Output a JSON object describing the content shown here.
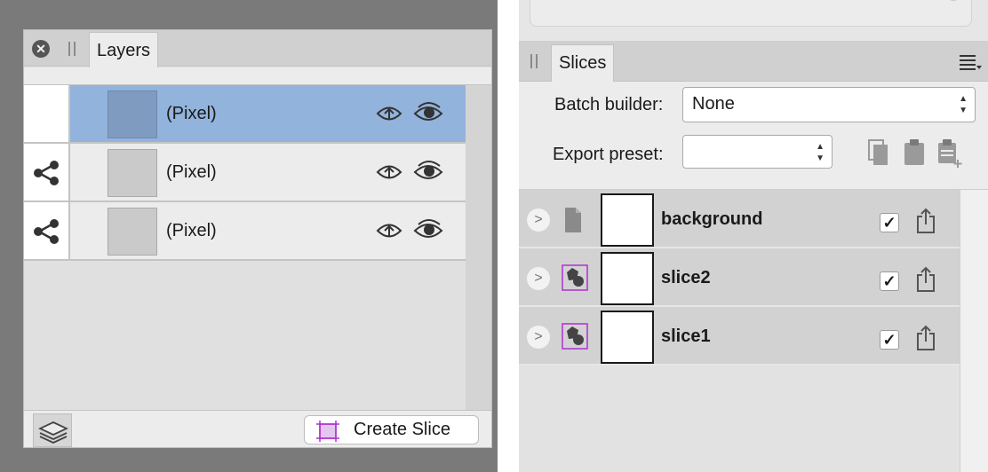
{
  "layers_panel": {
    "tab_label": "Layers",
    "layers": [
      {
        "label": "(Pixel)",
        "selected": true,
        "has_link": false
      },
      {
        "label": "(Pixel)",
        "selected": false,
        "has_link": true
      },
      {
        "label": "(Pixel)",
        "selected": false,
        "has_link": true
      }
    ],
    "footer": {
      "create_slice_label": "Create Slice"
    }
  },
  "slices_panel": {
    "tab_label": "Slices",
    "batch_builder": {
      "label": "Batch builder:",
      "value": "None"
    },
    "export_preset": {
      "label": "Export preset:",
      "value": ""
    },
    "slices": [
      {
        "name": "background",
        "type_icon": "document-icon",
        "checked": true
      },
      {
        "name": "slice2",
        "type_icon": "shapes-icon",
        "checked": true
      },
      {
        "name": "slice1",
        "type_icon": "shapes-icon",
        "checked": true
      }
    ]
  },
  "icons": {
    "close": "close-icon",
    "link": "share-link-icon",
    "eye_up": "eye-up-icon",
    "eye": "eye-icon",
    "layers_stack": "layers-stack-icon",
    "slice_tool": "slice-icon",
    "menu": "menu-icon",
    "copy": "copy-icon",
    "paste": "paste-icon",
    "paste_add": "paste-add-icon",
    "expand": "chevron-right-icon",
    "export": "export-icon"
  },
  "colors": {
    "selection": "#92b3dc",
    "slice_accent": "#b02fd1",
    "panel_bg": "#e0e0e0",
    "backdrop": "#7a7a7a"
  }
}
